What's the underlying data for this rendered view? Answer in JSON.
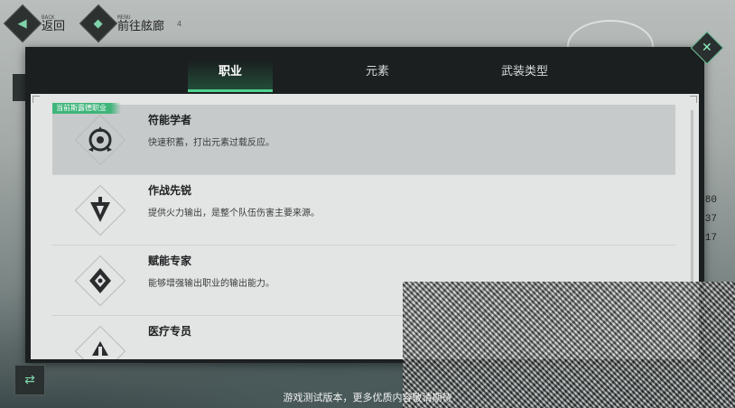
{
  "top_nav": {
    "back_small": "BACK",
    "back_label": "返回",
    "gallery_small": "MENU",
    "gallery_label": "前往舷廊",
    "gallery_badge": "4"
  },
  "tabs": [
    {
      "label": "职业",
      "active": true
    },
    {
      "label": "元素",
      "active": false
    },
    {
      "label": "武装类型",
      "active": false
    }
  ],
  "current_tag": "当前斯露德职业",
  "roles": [
    {
      "title": "符能学者",
      "desc": "快速积蓄，打出元素过载反应。",
      "icon": "scholar-icon",
      "selected": true
    },
    {
      "title": "作战先锐",
      "desc": "提供火力输出，是整个队伍伤害主要来源。",
      "icon": "vanguard-icon",
      "selected": false
    },
    {
      "title": "赋能专家",
      "desc": "能够增强输出职业的输出能力。",
      "icon": "enabler-icon",
      "selected": false
    },
    {
      "title": "医疗专员",
      "desc": "",
      "icon": "medic-icon",
      "selected": false
    }
  ],
  "right_stats": [
    "80",
    "37",
    "17"
  ],
  "footer": {
    "notice": "游戏测试版本，更多优质内容敬请期待"
  },
  "colors": {
    "accent": "#4fd18d",
    "dialog_bg": "#1b1f20",
    "panel_bg": "#e3e4e4"
  }
}
